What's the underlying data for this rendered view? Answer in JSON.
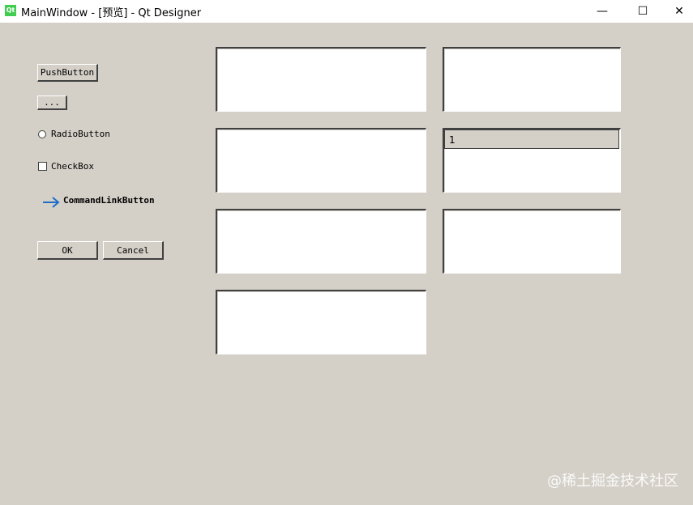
{
  "window": {
    "icon_text": "Qt",
    "title": "MainWindow - [预览] - Qt Designer",
    "minimize_glyph": "—",
    "maximize_glyph": "☐",
    "close_glyph": "✕"
  },
  "widgets": {
    "push_button_label": "PushButton",
    "tool_button_label": "...",
    "radio_label": "RadioButton",
    "checkbox_label": "CheckBox",
    "command_link_label": "CommandLinkButton",
    "ok_label": "OK",
    "cancel_label": "Cancel"
  },
  "table": {
    "header_value": "1"
  },
  "watermark": "@稀土掘金技术社区",
  "colors": {
    "background": "#d4d0c8",
    "arrow": "#1e6ec8"
  }
}
